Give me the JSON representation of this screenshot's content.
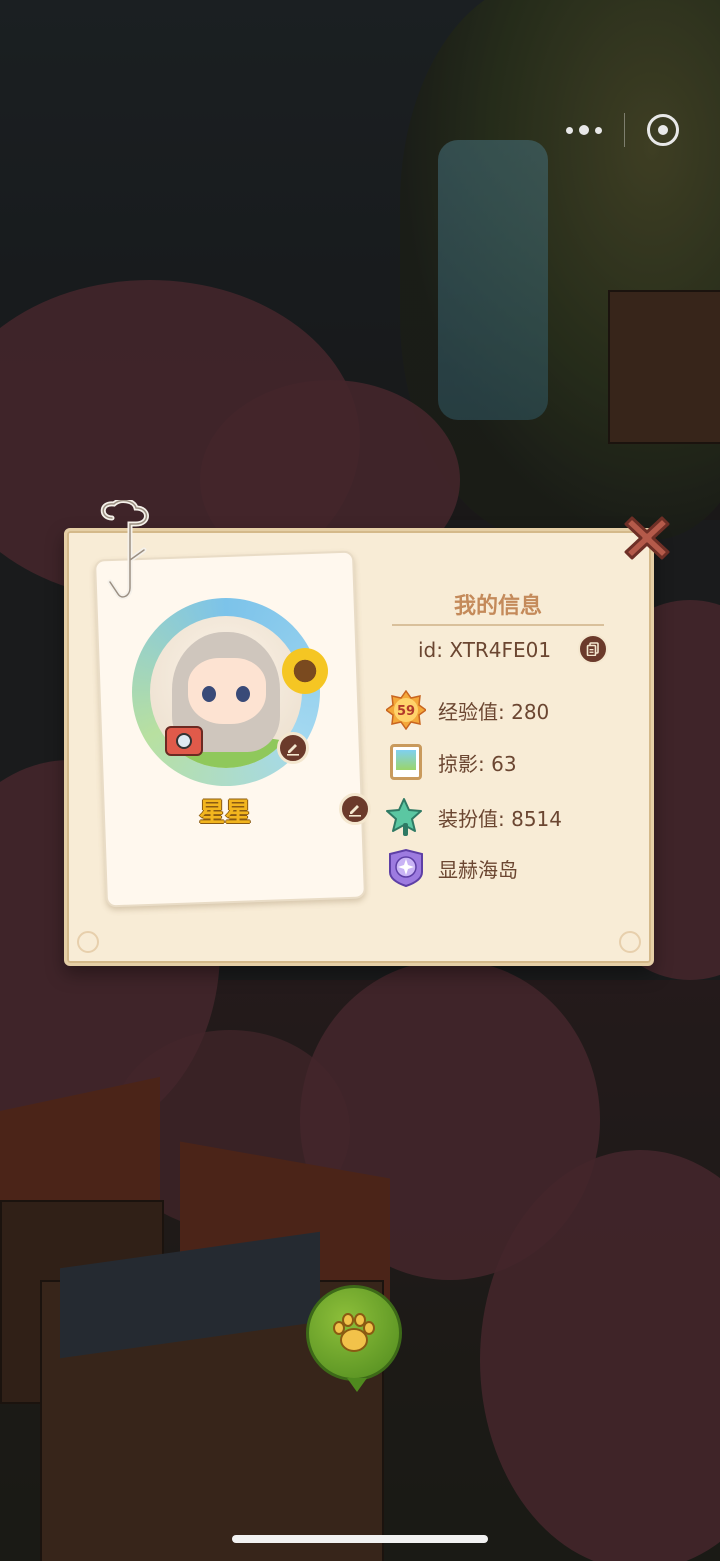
{
  "header": {
    "more_icon": "more-dots-icon",
    "target_icon": "target-icon"
  },
  "modal": {
    "title": "我的信息",
    "id_text": "id: XTR4FE01",
    "nickname": "星星",
    "stats": [
      {
        "icon": "level-badge-icon",
        "badge_text": "59",
        "text": "经验值: 280"
      },
      {
        "icon": "photo-frame-icon",
        "text": "掠影: 63"
      },
      {
        "icon": "star-wand-icon",
        "text": "装扮值: 8514"
      },
      {
        "icon": "island-medal-icon",
        "text": "显赫海岛"
      }
    ]
  },
  "colors": {
    "card_bg": "#f8ecd6",
    "accent_brown": "#6b3a2b",
    "title_color": "#c48a5a",
    "nickname_color": "#f2b51e",
    "close_red": "#b45a4a",
    "paw_green": "#6aa52a"
  }
}
